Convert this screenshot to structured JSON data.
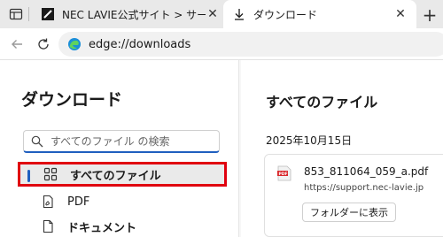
{
  "tabs": [
    {
      "title": "NEC LAVIE公式サイト > サービス＆サポ",
      "icon": "nec-favicon",
      "active": false
    },
    {
      "title": "ダウンロード",
      "icon": "download-icon",
      "active": true
    }
  ],
  "addressbar": {
    "url": "edge://downloads",
    "icon": "edge-icon"
  },
  "sidebar": {
    "title": "ダウンロード",
    "search_placeholder": "すべてのファイル の検索",
    "items": [
      {
        "label": "すべてのファイル",
        "icon": "grid-icon",
        "selected": true
      },
      {
        "label": "PDF",
        "icon": "pdf-file-icon",
        "selected": false
      },
      {
        "label": "ドキュメント",
        "icon": "document-icon",
        "selected": false
      }
    ]
  },
  "main": {
    "title": "すべてのファイル",
    "date": "2025年10月15日",
    "download": {
      "filename": "853_811064_059_a.pdf",
      "source": "https://support.nec-lavie.jp",
      "button_label": "フォルダーに表示",
      "icon": "pdf-icon"
    }
  },
  "colors": {
    "accent": "#1f5fbf",
    "highlight": "#e0000f"
  }
}
